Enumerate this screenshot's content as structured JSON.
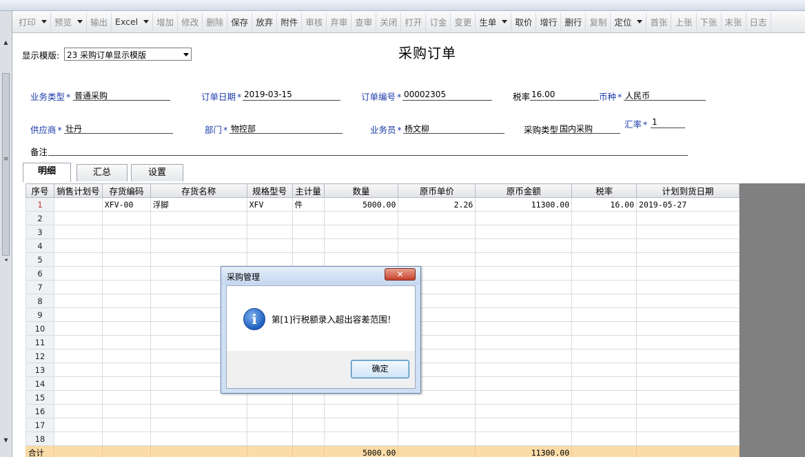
{
  "toolbar": {
    "items": [
      {
        "label": "打印",
        "caret": true,
        "enabled": false
      },
      {
        "label": "预览",
        "caret": true,
        "enabled": false
      },
      {
        "label": "输出",
        "caret": false,
        "enabled": false
      },
      {
        "label": "Excel",
        "caret": true,
        "enabled": true
      },
      {
        "label": "增加",
        "caret": false,
        "enabled": false
      },
      {
        "label": "修改",
        "caret": false,
        "enabled": false
      },
      {
        "label": "删除",
        "caret": false,
        "enabled": false
      },
      {
        "label": "保存",
        "caret": false,
        "enabled": true
      },
      {
        "label": "放弃",
        "caret": false,
        "enabled": true
      },
      {
        "label": "附件",
        "caret": false,
        "enabled": true
      },
      {
        "label": "审核",
        "caret": false,
        "enabled": false
      },
      {
        "label": "弃审",
        "caret": false,
        "enabled": false
      },
      {
        "label": "查审",
        "caret": false,
        "enabled": false
      },
      {
        "label": "关闭",
        "caret": false,
        "enabled": false
      },
      {
        "label": "打开",
        "caret": false,
        "enabled": false
      },
      {
        "label": "订金",
        "caret": false,
        "enabled": false
      },
      {
        "label": "变更",
        "caret": false,
        "enabled": false
      },
      {
        "label": "生单",
        "caret": true,
        "enabled": true
      },
      {
        "label": "取价",
        "caret": false,
        "enabled": true
      },
      {
        "label": "增行",
        "caret": false,
        "enabled": true
      },
      {
        "label": "删行",
        "caret": false,
        "enabled": true
      },
      {
        "label": "复制",
        "caret": false,
        "enabled": false
      },
      {
        "label": "定位",
        "caret": true,
        "enabled": true
      },
      {
        "label": "首张",
        "caret": false,
        "enabled": false
      },
      {
        "label": "上张",
        "caret": false,
        "enabled": false
      },
      {
        "label": "下张",
        "caret": false,
        "enabled": false
      },
      {
        "label": "末张",
        "caret": false,
        "enabled": false
      },
      {
        "label": "日志",
        "caret": false,
        "enabled": false
      }
    ]
  },
  "form": {
    "title": "采购订单",
    "template_label": "显示模版:",
    "template_value": "23 采购订单显示模版",
    "fields": {
      "business_type": {
        "label": "业务类型",
        "value": "普通采购"
      },
      "order_date": {
        "label": "订单日期",
        "value": "2019-03-15"
      },
      "order_no": {
        "label": "订单编号",
        "value": "00002305"
      },
      "tax_rate": {
        "label": "税率",
        "value": "16.00"
      },
      "currency": {
        "label": "币种",
        "value": "人民币"
      },
      "supplier": {
        "label": "供应商",
        "value": "壮丹"
      },
      "department": {
        "label": "部门",
        "value": "物控部"
      },
      "salesperson": {
        "label": "业务员",
        "value": "杨文柳"
      },
      "purchase_type": {
        "label": "采购类型",
        "value": "国内采购"
      },
      "exchange_rate": {
        "label": "汇率",
        "value": "1"
      },
      "remark": {
        "label": "备注",
        "value": ""
      }
    },
    "required_mark": "*"
  },
  "tabs": [
    {
      "label": "明细",
      "active": true
    },
    {
      "label": "汇总",
      "active": false
    },
    {
      "label": "设置",
      "active": false
    }
  ],
  "grid": {
    "headers": [
      "序号",
      "销售计划号",
      "存货编码",
      "存货名称",
      "规格型号",
      "主计量",
      "数量",
      "原币单价",
      "原币金额",
      "税率",
      "计划到货日期"
    ],
    "rows": [
      [
        "1",
        "",
        "XFV-00",
        "浮脚",
        "XFV",
        "件",
        "5000.00",
        "2.26",
        "11300.00",
        "16.00",
        "2019-05-27"
      ],
      [
        "2",
        "",
        "",
        "",
        "",
        "",
        "",
        "",
        "",
        "",
        ""
      ],
      [
        "3",
        "",
        "",
        "",
        "",
        "",
        "",
        "",
        "",
        "",
        ""
      ],
      [
        "4",
        "",
        "",
        "",
        "",
        "",
        "",
        "",
        "",
        "",
        ""
      ],
      [
        "5",
        "",
        "",
        "",
        "",
        "",
        "",
        "",
        "",
        "",
        ""
      ],
      [
        "6",
        "",
        "",
        "",
        "",
        "",
        "",
        "",
        "",
        "",
        ""
      ],
      [
        "7",
        "",
        "",
        "",
        "",
        "",
        "",
        "",
        "",
        "",
        ""
      ],
      [
        "8",
        "",
        "",
        "",
        "",
        "",
        "",
        "",
        "",
        "",
        ""
      ],
      [
        "9",
        "",
        "",
        "",
        "",
        "",
        "",
        "",
        "",
        "",
        ""
      ],
      [
        "10",
        "",
        "",
        "",
        "",
        "",
        "",
        "",
        "",
        "",
        ""
      ],
      [
        "11",
        "",
        "",
        "",
        "",
        "",
        "",
        "",
        "",
        "",
        ""
      ],
      [
        "12",
        "",
        "",
        "",
        "",
        "",
        "",
        "",
        "",
        "",
        ""
      ],
      [
        "13",
        "",
        "",
        "",
        "",
        "",
        "",
        "",
        "",
        "",
        ""
      ],
      [
        "14",
        "",
        "",
        "",
        "",
        "",
        "",
        "",
        "",
        "",
        ""
      ],
      [
        "15",
        "",
        "",
        "",
        "",
        "",
        "",
        "",
        "",
        "",
        ""
      ],
      [
        "16",
        "",
        "",
        "",
        "",
        "",
        "",
        "",
        "",
        "",
        ""
      ],
      [
        "17",
        "",
        "",
        "",
        "",
        "",
        "",
        "",
        "",
        "",
        ""
      ],
      [
        "18",
        "",
        "",
        "",
        "",
        "",
        "",
        "",
        "",
        "",
        ""
      ]
    ],
    "total_row": [
      "合计",
      "",
      "",
      "",
      "",
      "",
      "5000.00",
      "",
      "11300.00",
      "",
      ""
    ]
  },
  "dialog": {
    "title": "采购管理",
    "close_label": "x",
    "icon": "info-icon",
    "message": "第[1]行税额录入超出容差范围！",
    "ok_label": "确定"
  },
  "colors": {
    "field_label": "#1a3aa8",
    "total_row_bg": "#fbdca8",
    "gray_area": "#808080",
    "first_row_no": "#c03030"
  }
}
